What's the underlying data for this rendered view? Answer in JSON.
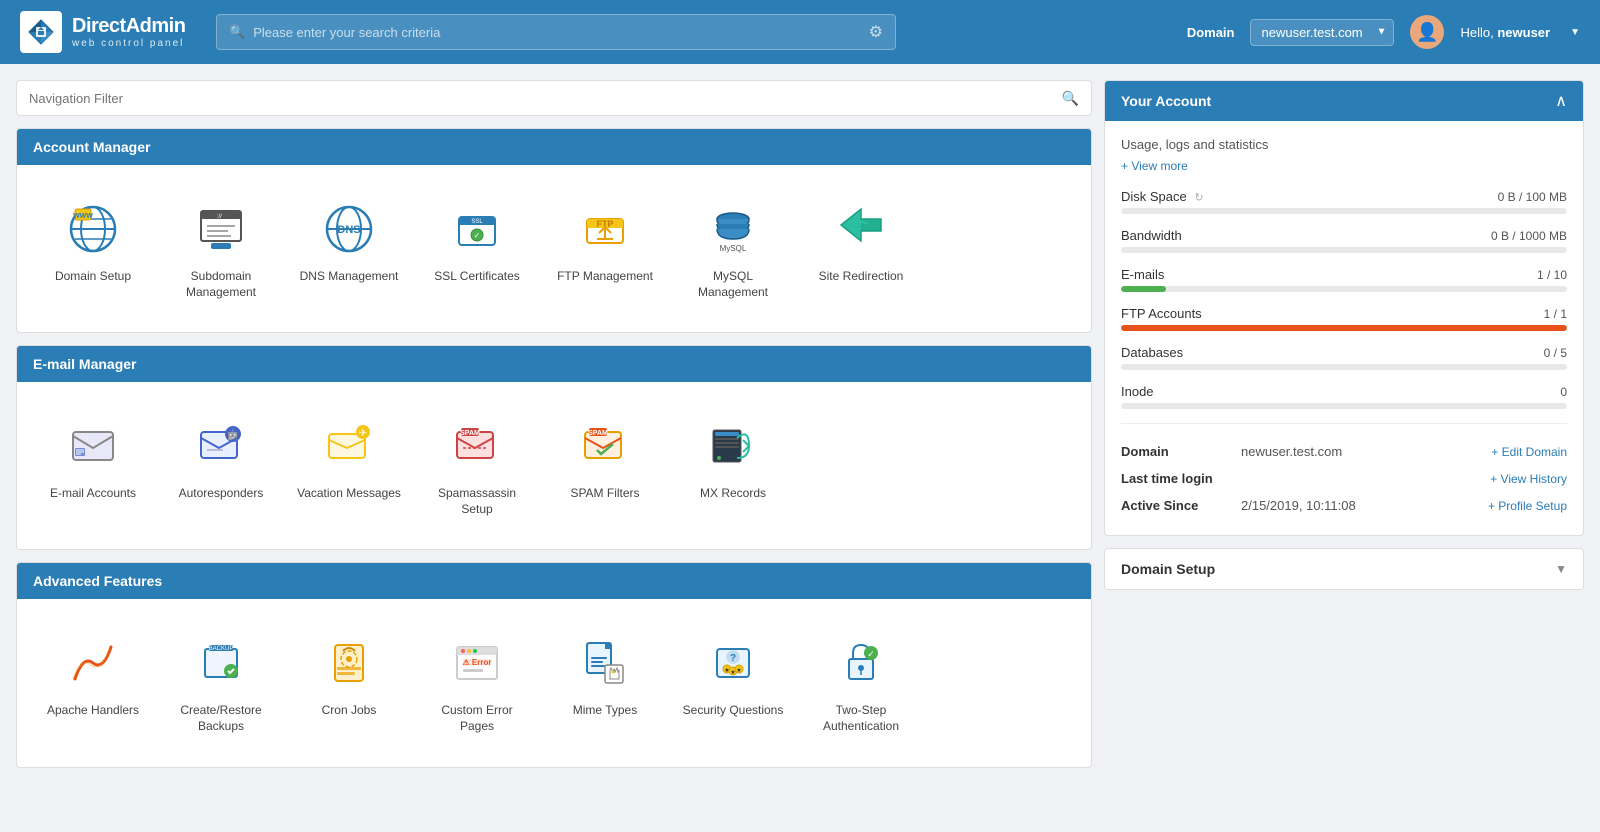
{
  "navbar": {
    "brand": "DirectAdmin",
    "sub": "web control panel",
    "search_placeholder": "Please enter your search criteria",
    "domain_label": "Domain",
    "domain_value": "newuser.test.com",
    "hello": "Hello, ",
    "username": "newuser"
  },
  "nav_filter": {
    "placeholder": "Navigation Filter"
  },
  "sections": {
    "account_manager": {
      "label": "Account Manager",
      "items": [
        {
          "id": "domain-setup",
          "label": "Domain Setup"
        },
        {
          "id": "subdomain-management",
          "label": "Subdomain Management"
        },
        {
          "id": "dns-management",
          "label": "DNS Management"
        },
        {
          "id": "ssl-certificates",
          "label": "SSL Certificates"
        },
        {
          "id": "ftp-management",
          "label": "FTP Management"
        },
        {
          "id": "mysql-management",
          "label": "MySQL Management"
        },
        {
          "id": "site-redirection",
          "label": "Site Redirection"
        }
      ]
    },
    "email_manager": {
      "label": "E-mail Manager",
      "items": [
        {
          "id": "email-accounts",
          "label": "E-mail Accounts"
        },
        {
          "id": "autoresponders",
          "label": "Autoresponders"
        },
        {
          "id": "vacation-messages",
          "label": "Vacation Messages"
        },
        {
          "id": "spamassassin-setup",
          "label": "Spamassassin Setup"
        },
        {
          "id": "spam-filters",
          "label": "SPAM Filters"
        },
        {
          "id": "mx-records",
          "label": "MX Records"
        }
      ]
    },
    "advanced_features": {
      "label": "Advanced Features",
      "items": [
        {
          "id": "apache-handlers",
          "label": "Apache Handlers"
        },
        {
          "id": "create-restore-backups",
          "label": "Create/Restore Backups"
        },
        {
          "id": "cron-jobs",
          "label": "Cron Jobs"
        },
        {
          "id": "custom-error-pages",
          "label": "Custom Error Pages"
        },
        {
          "id": "mime-types",
          "label": "Mime Types"
        },
        {
          "id": "security-questions",
          "label": "Security Questions"
        },
        {
          "id": "two-step-authentication",
          "label": "Two-Step Authentication"
        }
      ]
    }
  },
  "account": {
    "title": "Your Account",
    "subtitle": "Usage, logs and statistics",
    "view_more": "+ View more",
    "stats": [
      {
        "label": "Disk Space",
        "value": "0 B / 100 MB",
        "pct": 0,
        "color": "blue",
        "refresh": true
      },
      {
        "label": "Bandwidth",
        "value": "0 B / 1000 MB",
        "pct": 0,
        "color": "blue",
        "refresh": false
      },
      {
        "label": "E-mails",
        "value": "1 / 10",
        "pct": 10,
        "color": "green",
        "refresh": false
      },
      {
        "label": "FTP Accounts",
        "value": "1 / 1",
        "pct": 100,
        "color": "orange",
        "refresh": false
      },
      {
        "label": "Databases",
        "value": "0 / 5",
        "pct": 0,
        "color": "blue",
        "refresh": false
      },
      {
        "label": "Inode",
        "value": "0",
        "pct": 0,
        "color": "blue",
        "refresh": false
      }
    ],
    "info": {
      "domain_label": "Domain",
      "domain_value": "newuser.test.com",
      "edit_domain": "+ Edit Domain",
      "last_login_label": "Last time login",
      "view_history": "+ View History",
      "active_since_label": "Active Since",
      "active_since_value": "2/15/2019, 10:11:08",
      "profile_setup": "+ Profile Setup"
    }
  },
  "domain_setup": {
    "label": "Domain Setup"
  }
}
